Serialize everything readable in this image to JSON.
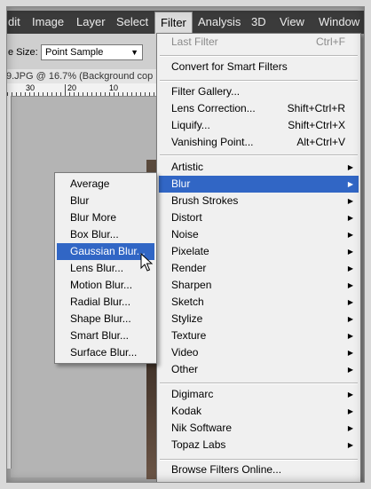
{
  "menubar": {
    "items": [
      "dit",
      "Image",
      "Layer",
      "Select",
      "Filter",
      "Analysis",
      "3D",
      "View",
      "Window"
    ],
    "active": "Filter"
  },
  "options": {
    "size_label": "e Size:",
    "size_value": "Point Sample"
  },
  "document": {
    "tab_title": "9.JPG @ 16.7% (Background cop",
    "ruler_numbers": [
      "30",
      "20",
      "10"
    ]
  },
  "filter_menu": {
    "last_filter": {
      "label": "Last Filter",
      "shortcut": "Ctrl+F"
    },
    "group1": [
      {
        "label": "Convert for Smart Filters"
      }
    ],
    "group2": [
      {
        "label": "Filter Gallery..."
      },
      {
        "label": "Lens Correction...",
        "shortcut": "Shift+Ctrl+R"
      },
      {
        "label": "Liquify...",
        "shortcut": "Shift+Ctrl+X"
      },
      {
        "label": "Vanishing Point...",
        "shortcut": "Alt+Ctrl+V"
      }
    ],
    "group3": [
      "Artistic",
      "Blur",
      "Brush Strokes",
      "Distort",
      "Noise",
      "Pixelate",
      "Render",
      "Sharpen",
      "Sketch",
      "Stylize",
      "Texture",
      "Video",
      "Other"
    ],
    "group4": [
      "Digimarc",
      "Kodak",
      "Nik Software",
      "Topaz Labs"
    ],
    "group5": [
      {
        "label": "Browse Filters Online..."
      }
    ],
    "highlighted": "Blur"
  },
  "blur_menu": {
    "items": [
      "Average",
      "Blur",
      "Blur More",
      "Box Blur...",
      "Gaussian Blur...",
      "Lens Blur...",
      "Motion Blur...",
      "Radial Blur...",
      "Shape Blur...",
      "Smart Blur...",
      "Surface Blur..."
    ],
    "highlighted": "Gaussian Blur..."
  },
  "colors": {
    "menubar": "#3b3b3b",
    "highlight": "#3166c5",
    "menu_bg": "#f0f0f0"
  },
  "icons": {
    "submenu_arrow": "triangle-right-icon",
    "cursor": "arrow-cursor-icon",
    "dropdown": "chevron-down-icon"
  }
}
